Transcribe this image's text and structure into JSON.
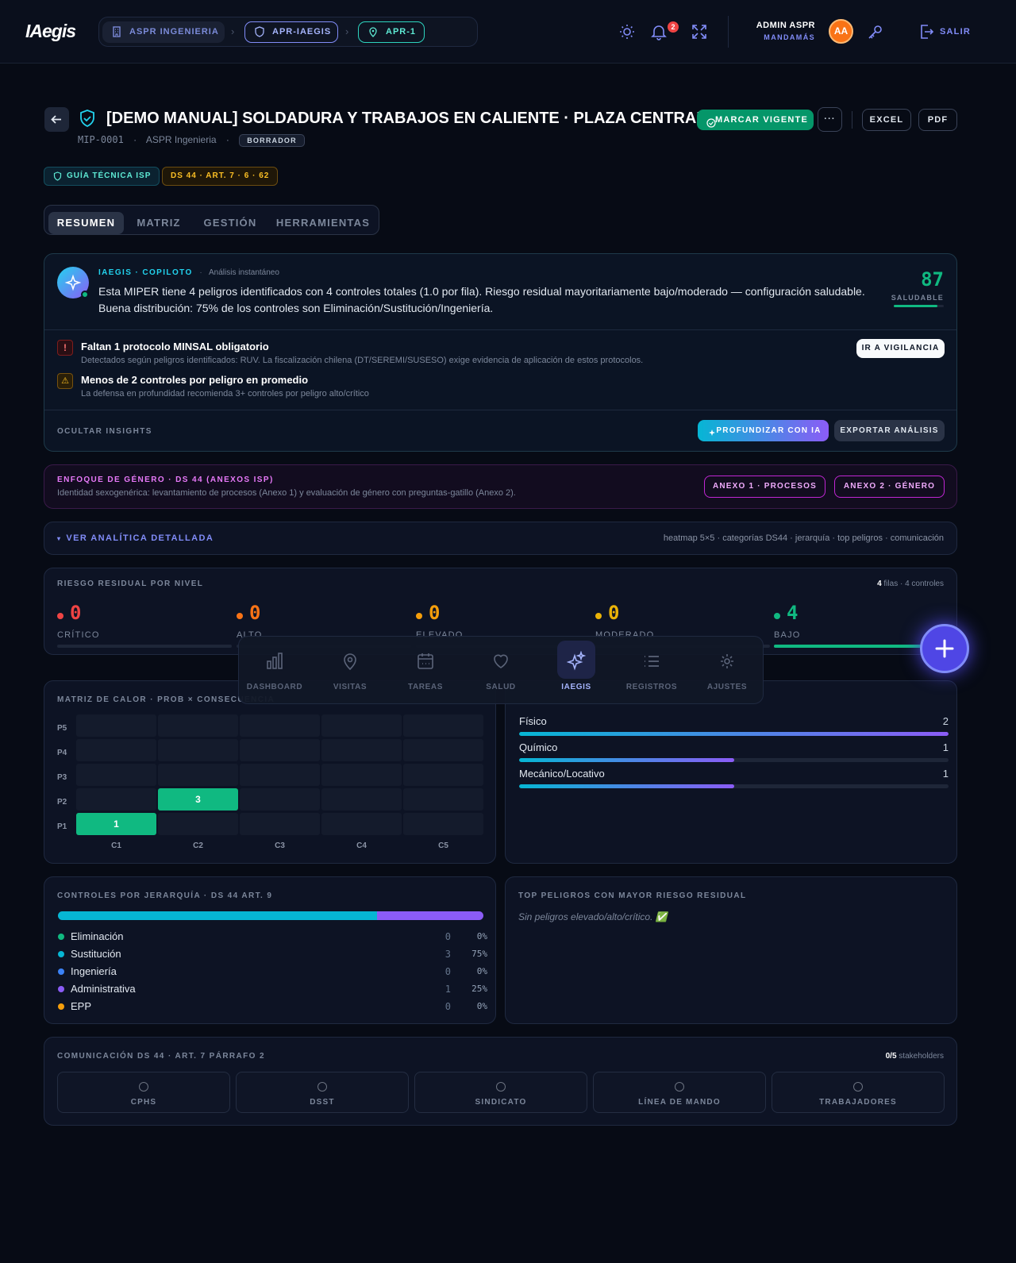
{
  "header": {
    "logo": "IAegis",
    "breadcrumb": [
      "ASPR INGENIERIA",
      "APR-IAEGIS",
      "APR-1"
    ],
    "notification_count": "2",
    "user_name": "ADMIN ASPR",
    "user_role": "MANDAMÁS",
    "avatar_initials": "AA",
    "logout_label": "SALIR"
  },
  "page": {
    "title": "[DEMO MANUAL] SOLDADURA Y TRABAJOS EN CALIENTE · PLAZA CENTRAL",
    "code": "MIP-0001",
    "company": "ASPR Ingenieria",
    "status": "BORRADOR",
    "mark_button": "MARCAR VIGENTE",
    "more_button": "···",
    "excel_button": "EXCEL",
    "pdf_button": "PDF",
    "tags": [
      "GUÍA TÉCNICA ISP",
      "DS 44 · ART. 7 · 6 · 62"
    ]
  },
  "tabs": [
    "RESUMEN",
    "MATRIZ",
    "GESTIÓN",
    "HERRAMIENTAS"
  ],
  "active_tab": "RESUMEN",
  "copilot": {
    "title": "IAEGIS · COPILOTO",
    "subtitle": "Análisis instantáneo",
    "text": "Esta MIPER tiene 4 peligros identificados con 4 controles totales (1.0 por fila). Riesgo residual mayoritariamente bajo/moderado — configuración saludable. Buena distribución: 75% de los controles son Eliminación/Sustitución/Ingeniería.",
    "score": "87",
    "score_label": "SALUDABLE",
    "score_fraction": 0.87,
    "insights": [
      {
        "title": "Faltan 1 protocolo MINSAL obligatorio",
        "desc": "Detectados según peligros identificados: RUV. La fiscalización chilena (DT/SEREMI/SUSESO) exige evidencia de aplicación de estos protocolos.",
        "icon": "!"
      },
      {
        "title": "Menos de 2 controles por peligro en promedio",
        "desc": "La defensa en profundidad recomienda 3+ controles por peligro alto/crítico",
        "icon": "⚠"
      }
    ],
    "vigilancia_button": "IR A VIGILANCIA",
    "hide_label": "OCULTAR INSIGHTS",
    "deepen_button": "PROFUNDIZAR CON IA",
    "export_button": "EXPORTAR ANÁLISIS"
  },
  "gender": {
    "title": "ENFOQUE DE GÉNERO · DS 44 (ANEXOS ISP)",
    "text": "Identidad sexogenérica: levantamiento de procesos (Anexo 1) y evaluación de género con preguntas-gatillo (Anexo 2).",
    "annex1": "ANEXO 1 · PROCESOS",
    "annex2": "ANEXO 2 · GÉNERO"
  },
  "analytics": {
    "label": "VER ANALÍTICA DETALLADA",
    "caret": "▾",
    "hint": "heatmap 5×5 · categorías DS44 · jerarquía · top peligros · comunicación"
  },
  "residual": {
    "title": "RIESGO RESIDUAL POR NIVEL",
    "rows_count": "4",
    "rows_text": "filas · 4 controles",
    "levels": [
      {
        "name": "CRÍTICO",
        "value": "0",
        "color": "#ef4444",
        "fraction": 0
      },
      {
        "name": "ALTO",
        "value": "0",
        "color": "#f97316",
        "fraction": 0
      },
      {
        "name": "ELEVADO",
        "value": "0",
        "color": "#f59e0b",
        "fraction": 0
      },
      {
        "name": "MODERADO",
        "value": "0",
        "color": "#eab308",
        "fraction": 0
      },
      {
        "name": "BAJO",
        "value": "4",
        "color": "#10b981",
        "fraction": 1
      }
    ]
  },
  "heatmap": {
    "title": "MATRIZ DE CALOR · PROB × CONSECUENCIA",
    "rows": [
      "P5",
      "P4",
      "P3",
      "P2",
      "P1"
    ],
    "cols": [
      "C1",
      "C2",
      "C3",
      "C4",
      "C5"
    ],
    "cells": [
      [
        "",
        "",
        "",
        "",
        ""
      ],
      [
        "",
        "",
        "",
        "",
        ""
      ],
      [
        "",
        "",
        "",
        "",
        ""
      ],
      [
        "",
        "3",
        "",
        "",
        ""
      ],
      [
        "1",
        "",
        "",
        "",
        ""
      ]
    ]
  },
  "categories": {
    "items": [
      {
        "name": "Físico",
        "value": "2",
        "fraction": 1.0
      },
      {
        "name": "Químico",
        "value": "1",
        "fraction": 0.5
      },
      {
        "name": "Mecánico/Locativo",
        "value": "1",
        "fraction": 0.5
      }
    ]
  },
  "hierarchy": {
    "title": "CONTROLES POR JERARQUÍA · DS 44 ART. 9",
    "items": [
      {
        "name": "Eliminación",
        "count": "0",
        "pct": "0%",
        "color": "#10b981",
        "fraction": 0
      },
      {
        "name": "Sustitución",
        "count": "3",
        "pct": "75%",
        "color": "#06b6d4",
        "fraction": 0.75
      },
      {
        "name": "Ingeniería",
        "count": "0",
        "pct": "0%",
        "color": "#3b82f6",
        "fraction": 0
      },
      {
        "name": "Administrativa",
        "count": "1",
        "pct": "25%",
        "color": "#8b5cf6",
        "fraction": 0.25
      },
      {
        "name": "EPP",
        "count": "0",
        "pct": "0%",
        "color": "#f59e0b",
        "fraction": 0
      }
    ]
  },
  "top_hazards": {
    "title": "TOP PELIGROS CON MAYOR RIESGO RESIDUAL",
    "empty": "Sin peligros elevado/alto/crítico. ✅"
  },
  "communication": {
    "title": "COMUNICACIÓN DS 44 · ART. 7 PÁRRAFO 2",
    "count": "0/5",
    "count_label": "stakeholders",
    "stakeholders": [
      "CPHS",
      "DSST",
      "SINDICATO",
      "LÍNEA DE MANDO",
      "TRABAJADORES"
    ]
  },
  "bottom_nav": {
    "items": [
      "DASHBOARD",
      "VISITAS",
      "TAREAS",
      "SALUD",
      "IAEGIS",
      "REGISTROS",
      "AJUSTES"
    ],
    "active": "IAEGIS"
  }
}
